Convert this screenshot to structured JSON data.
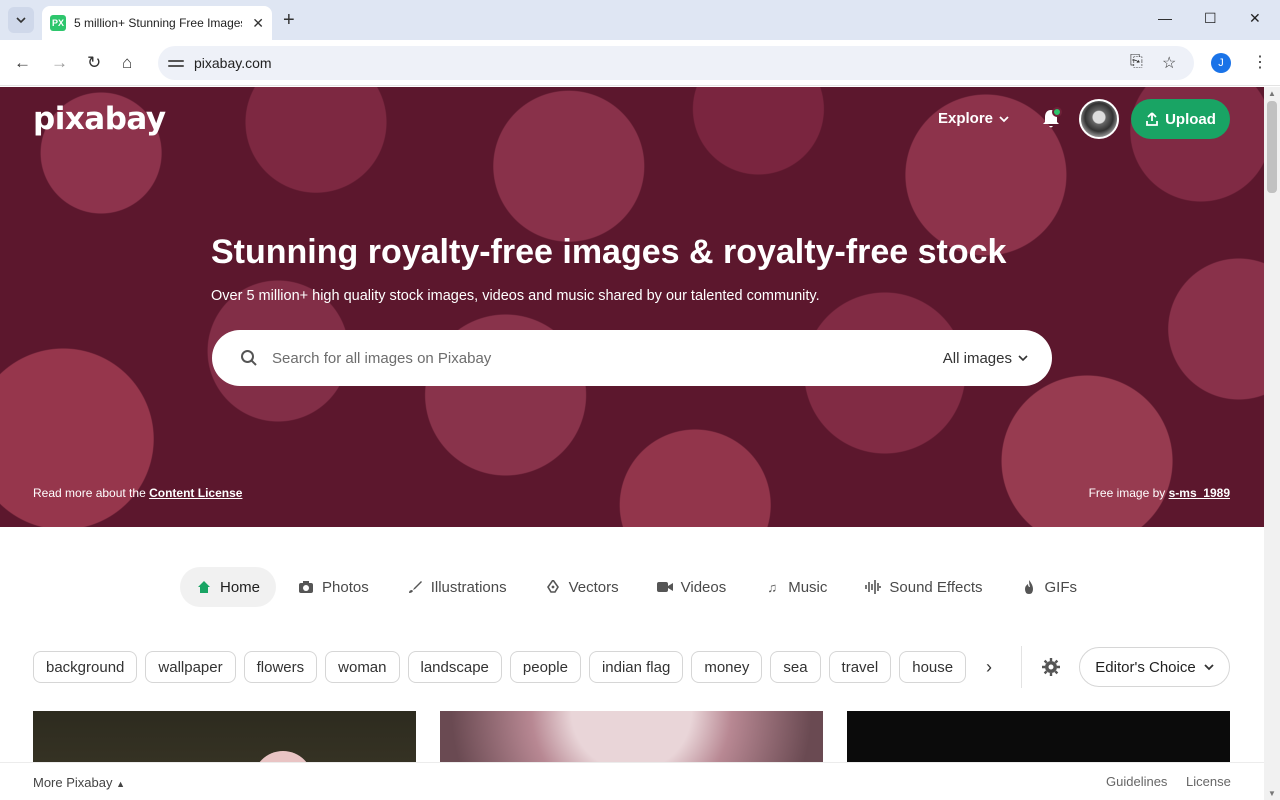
{
  "browser": {
    "tab_title": "5 million+ Stunning Free Images",
    "favicon_text": "PX",
    "url": "pixabay.com",
    "profile_initial": "J"
  },
  "header": {
    "logo": "pixabay",
    "explore_label": "Explore",
    "upload_label": "Upload"
  },
  "hero": {
    "title": "Stunning royalty-free images & royalty-free stock",
    "subtitle": "Over 5 million+ high quality stock images, videos and music shared by our talented community.",
    "search_placeholder": "Search for all images on Pixabay",
    "search_type": "All images",
    "license_prefix": "Read more about the ",
    "license_link": "Content License",
    "credit_prefix": "Free image by ",
    "credit_author": "s-ms_1989"
  },
  "media_tabs": [
    {
      "label": "Home",
      "icon": "home-icon"
    },
    {
      "label": "Photos",
      "icon": "camera-icon"
    },
    {
      "label": "Illustrations",
      "icon": "brush-icon"
    },
    {
      "label": "Vectors",
      "icon": "pen-nib-icon"
    },
    {
      "label": "Videos",
      "icon": "video-camera-icon"
    },
    {
      "label": "Music",
      "icon": "music-note-icon"
    },
    {
      "label": "Sound Effects",
      "icon": "sound-wave-icon"
    },
    {
      "label": "GIFs",
      "icon": "flame-icon"
    }
  ],
  "tags": [
    "background",
    "wallpaper",
    "flowers",
    "woman",
    "landscape",
    "people",
    "indian flag",
    "money",
    "sea",
    "travel",
    "house"
  ],
  "filter": {
    "sort_label": "Editor's Choice"
  },
  "footer": {
    "more_label": "More Pixabay",
    "guidelines": "Guidelines",
    "license": "License"
  },
  "colors": {
    "brand_green": "#19a464",
    "hero_base": "#6e2038"
  }
}
